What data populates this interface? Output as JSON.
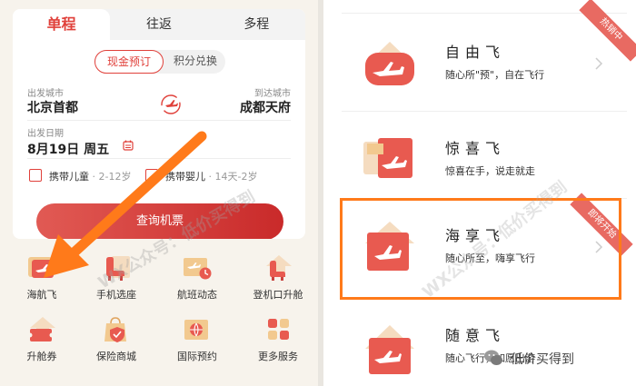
{
  "booking": {
    "tabs": [
      "单程",
      "往返",
      "多程"
    ],
    "pay_options": [
      "现金预订",
      "积分兑换"
    ],
    "from_label": "出发城市",
    "from_city": "北京首都",
    "to_label": "到达城市",
    "to_city": "成都天府",
    "date_label": "出发日期",
    "date_value": "8月19日  周五",
    "child_label": "携带儿童",
    "child_sub": "· 2-12岁",
    "infant_label": "携带婴儿",
    "infant_sub": "· 14天-2岁",
    "search_button": "查询机票"
  },
  "services": [
    {
      "label": "海航飞",
      "icon": "hainan-fly-icon"
    },
    {
      "label": "手机选座",
      "icon": "seat-select-icon"
    },
    {
      "label": "航班动态",
      "icon": "flight-status-icon"
    },
    {
      "label": "登机口升舱",
      "icon": "gate-upgrade-icon"
    },
    {
      "label": "升舱券",
      "icon": "upgrade-coupon-icon"
    },
    {
      "label": "保险商城",
      "icon": "insurance-shop-icon"
    },
    {
      "label": "国际预约",
      "icon": "international-booking-icon"
    },
    {
      "label": "更多服务",
      "icon": "more-services-icon"
    }
  ],
  "products": [
    {
      "title": "自由飞",
      "subtitle": "随心所\"预\"，自在飞行",
      "badge": "热销中"
    },
    {
      "title": "惊喜飞",
      "subtitle": "惊喜在手，说走就走",
      "badge": ""
    },
    {
      "title": "海享飞",
      "subtitle": "随心所至，嗨享飞行",
      "badge": "即将开始"
    },
    {
      "title": "随意飞",
      "subtitle": "随心飞行，如愿出游",
      "badge": ""
    }
  ],
  "watermark": "WX公众号：低价买得到",
  "brand": "低价买得到",
  "colors": {
    "accent": "#e0403a",
    "highlight": "#ff7a1a"
  }
}
